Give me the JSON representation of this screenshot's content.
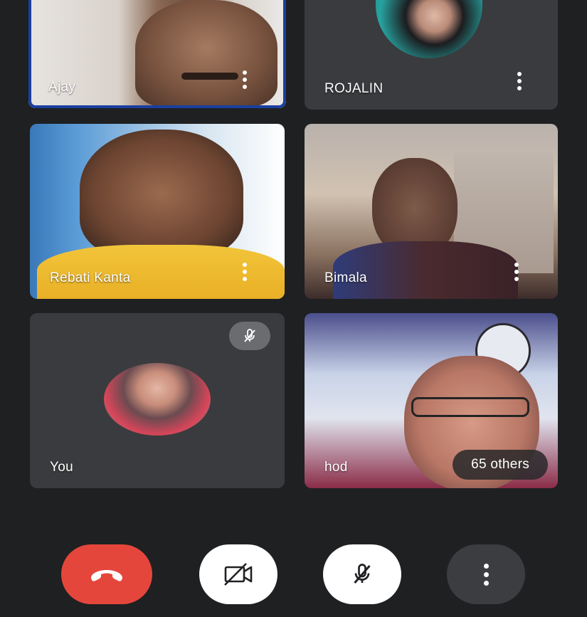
{
  "participants": [
    {
      "name": "Ajay"
    },
    {
      "name": "ROJALIN"
    },
    {
      "name": "Rebati Kanta"
    },
    {
      "name": "Bimala"
    },
    {
      "name": "You"
    },
    {
      "name": "hod"
    }
  ],
  "others_label": "65 others",
  "controls": {
    "end_call": {
      "icon": "phone-hangup-icon",
      "color": "#e5463b"
    },
    "camera": {
      "icon": "video-off-icon",
      "color": "#ffffff"
    },
    "mic": {
      "icon": "mic-off-icon",
      "color": "#ffffff"
    },
    "more": {
      "icon": "more-vertical-icon",
      "color": "#3c3d40"
    }
  },
  "colors": {
    "background": "#1f2022",
    "tile": "#3a3b3e",
    "active_speaker_border": "#1a3fa0",
    "end_call": "#e5463b"
  }
}
